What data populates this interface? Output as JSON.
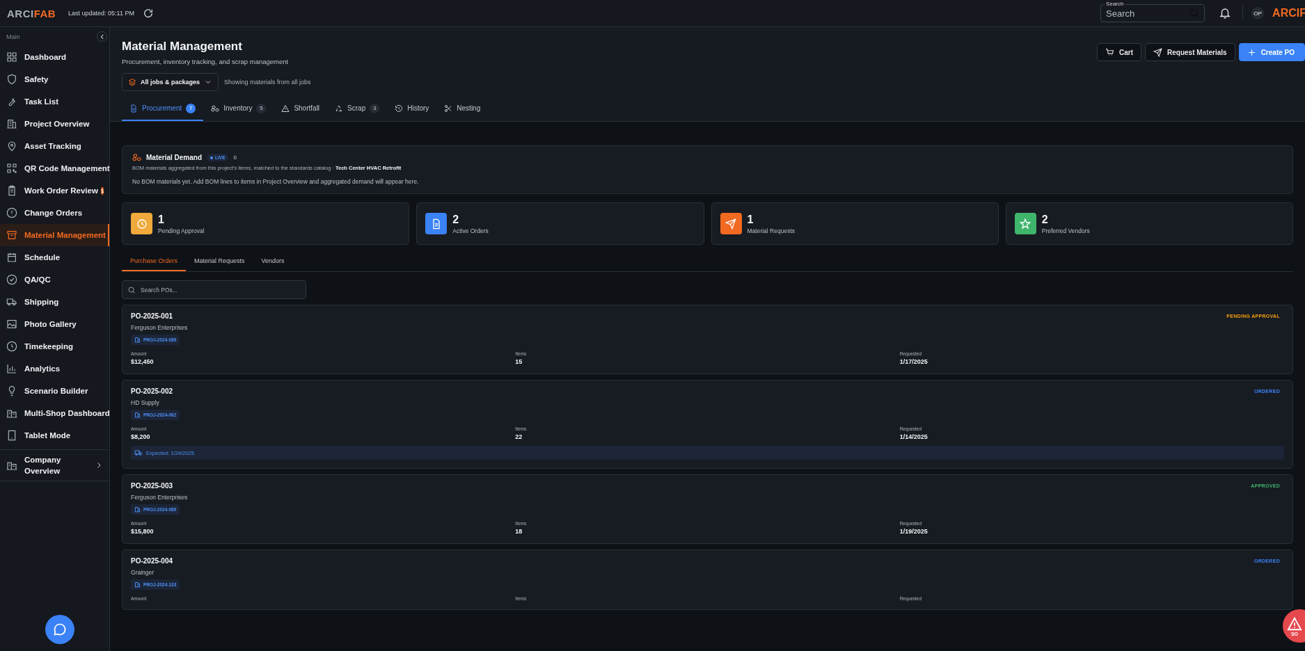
{
  "header": {
    "logo": {
      "left": "ARCI",
      "right": "FAB"
    },
    "last_updated": "Last updated: 05:11 PM",
    "search": {
      "label": "Search",
      "placeholder": "Search"
    },
    "avatar": "OP",
    "brand": "ARCIF"
  },
  "sidebar": {
    "section": "Main",
    "items": [
      {
        "label": "Dashboard",
        "selected": false
      },
      {
        "label": "Safety",
        "selected": false
      },
      {
        "label": "Task List",
        "selected": false
      },
      {
        "label": "Project Overview",
        "selected": false
      },
      {
        "label": "Asset Tracking",
        "selected": false
      },
      {
        "label": "QR Code Management",
        "selected": false
      },
      {
        "label": "Work Order Review",
        "selected": false,
        "badge": "1"
      },
      {
        "label": "Change Orders",
        "selected": false
      },
      {
        "label": "Material Management",
        "selected": true
      },
      {
        "label": "Schedule",
        "selected": false
      },
      {
        "label": "QA/QC",
        "selected": false
      },
      {
        "label": "Shipping",
        "selected": false
      },
      {
        "label": "Photo Gallery",
        "selected": false
      },
      {
        "label": "Timekeeping",
        "selected": false
      },
      {
        "label": "Analytics",
        "selected": false
      },
      {
        "label": "Scenario Builder",
        "selected": false
      },
      {
        "label": "Multi-Shop Dashboard",
        "selected": false
      },
      {
        "label": "Tablet Mode",
        "selected": false
      }
    ],
    "company": {
      "label": "Company Overview"
    }
  },
  "page": {
    "title": "Material Management",
    "subtitle": "Procurement, inventory tracking, and scrap management",
    "actions": [
      {
        "label": "Cart",
        "kind": "outline"
      },
      {
        "label": "Request Materials",
        "kind": "outline"
      },
      {
        "label": "Create PO",
        "kind": "primary"
      }
    ],
    "job_filter": "All jobs & packages",
    "filter_note": "Showing materials from all jobs",
    "tabs": [
      {
        "label": "Procurement",
        "count": "7",
        "selected": true
      },
      {
        "label": "Inventory",
        "count": "5",
        "selected": false
      },
      {
        "label": "Shortfall",
        "selected": false
      },
      {
        "label": "Scrap",
        "count": "3",
        "selected": false
      },
      {
        "label": "History",
        "selected": false
      },
      {
        "label": "Nesting",
        "selected": false
      }
    ]
  },
  "demand": {
    "title": "Material Demand",
    "live": "LIVE",
    "count": "0",
    "description": "BOM materials aggregated from this project's items, matched to the standards catalog · **Tech Center HVAC Retrofit**",
    "empty": "No BOM materials yet. Add BOM lines to items in Project Overview and aggregated demand will appear here."
  },
  "stats": [
    {
      "value": "1",
      "label": "Pending Approval",
      "color": "#f0a93b"
    },
    {
      "value": "2",
      "label": "Active Orders",
      "color": "#3b82f6"
    },
    {
      "value": "1",
      "label": "Material Requests",
      "color": "#f26a21"
    },
    {
      "value": "2",
      "label": "Preferred Vendors",
      "color": "#3fb56b"
    }
  ],
  "subtabs": [
    {
      "label": "Purchase Orders",
      "selected": true
    },
    {
      "label": "Material Requests",
      "selected": false
    },
    {
      "label": "Vendors",
      "selected": false
    }
  ],
  "po_search": {
    "placeholder": "Search POs..."
  },
  "orders": [
    {
      "number": "PO-2025-001",
      "vendor": "Ferguson Enterprises",
      "project": "PROJ-2024-089",
      "status": "PENDING APPROVAL",
      "color": "#f59e0b",
      "fields": [
        {
          "label": "Amount",
          "value": "$12,450"
        },
        {
          "label": "Items",
          "value": "15"
        },
        {
          "label": "Requested",
          "value": "1/17/2025"
        }
      ]
    },
    {
      "number": "PO-2025-002",
      "vendor": "HD Supply",
      "project": "PROJ-2024-062",
      "status": "ORDERED",
      "color": "#3b82f6",
      "fields": [
        {
          "label": "Amount",
          "value": "$8,200"
        },
        {
          "label": "Items",
          "value": "22"
        },
        {
          "label": "Requested",
          "value": "1/14/2025"
        }
      ],
      "expected": "Expected: 1/24/2025"
    },
    {
      "number": "PO-2025-003",
      "vendor": "Ferguson Enterprises",
      "project": "PROJ-2024-089",
      "status": "APPROVED",
      "color": "#3fb56b",
      "fields": [
        {
          "label": "Amount",
          "value": "$15,800"
        },
        {
          "label": "Items",
          "value": "18"
        },
        {
          "label": "Requested",
          "value": "1/19/2025"
        }
      ]
    },
    {
      "number": "PO-2025-004",
      "vendor": "Grainger",
      "project": "PROJ-2024-133",
      "status": "ORDERED",
      "color": "#3b82f6",
      "fields": [
        {
          "label": "Amount"
        },
        {
          "label": "Items"
        },
        {
          "label": "Requested"
        }
      ]
    }
  ],
  "sos": {
    "label": "SO"
  }
}
